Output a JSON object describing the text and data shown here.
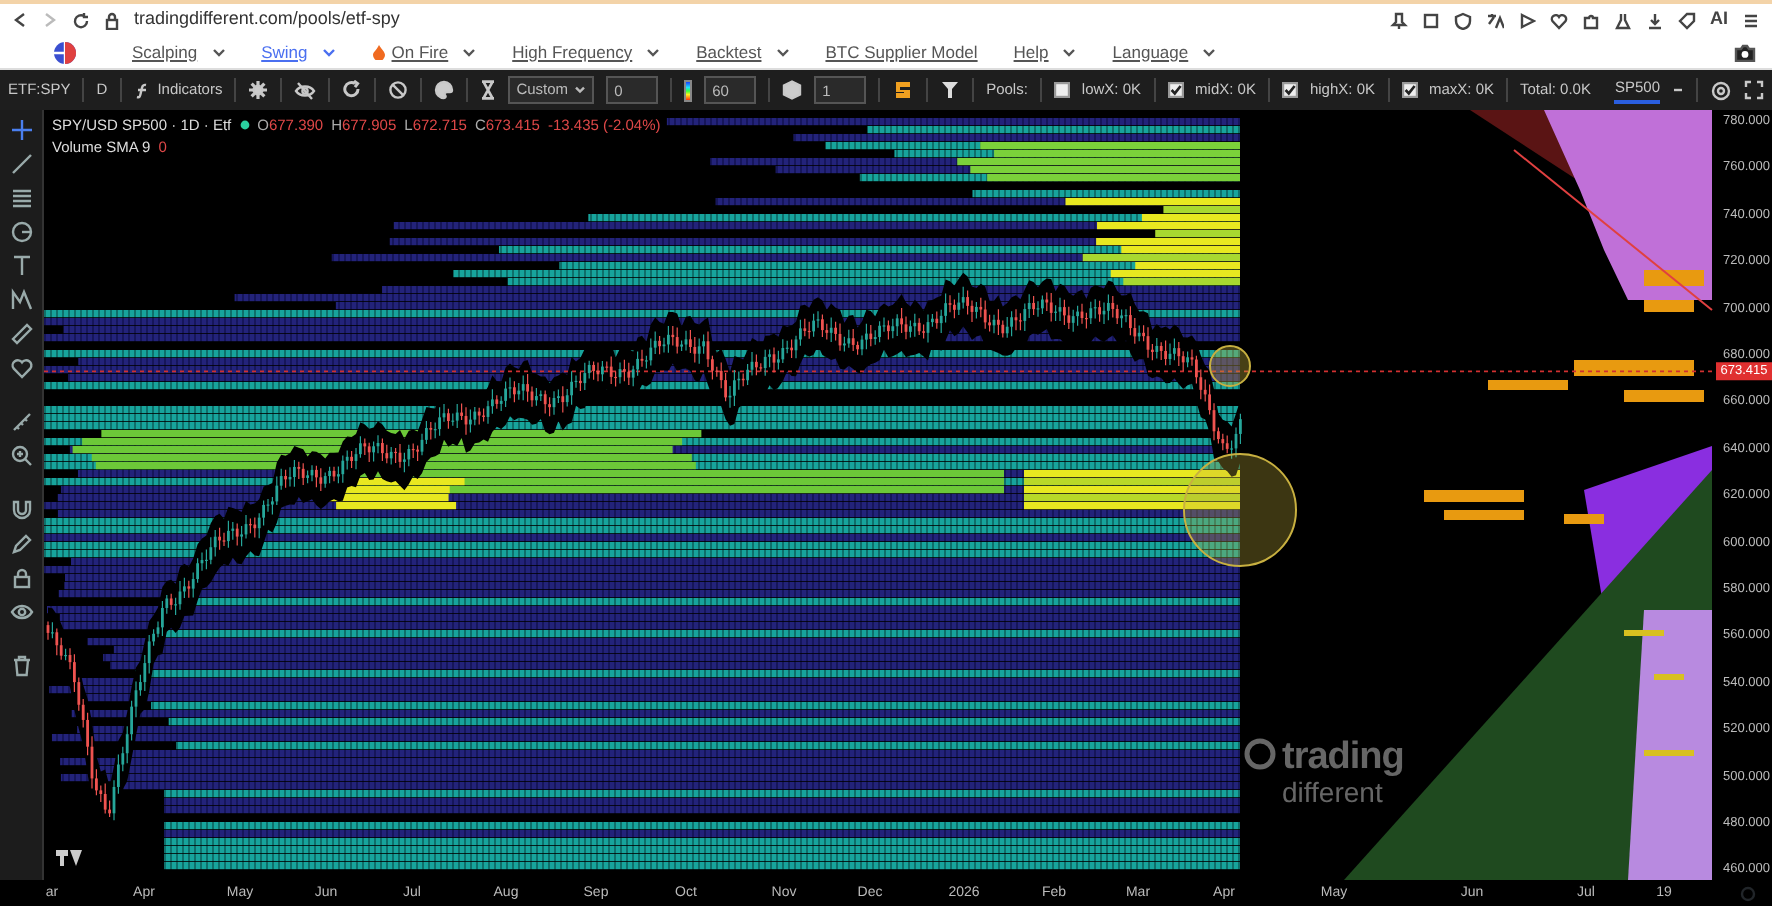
{
  "browser": {
    "url": "tradingdifferent.com/pools/etf-spy",
    "ai_label": "AI"
  },
  "nav": {
    "items": [
      {
        "label": "Scalping",
        "selected": false,
        "dropdown": true,
        "kind": "menu"
      },
      {
        "label": "Swing",
        "selected": true,
        "dropdown": true,
        "kind": "menu"
      },
      {
        "label": "On Fire",
        "selected": false,
        "dropdown": true,
        "kind": "hot"
      },
      {
        "label": "High Frequency",
        "selected": false,
        "dropdown": true,
        "kind": "menu"
      },
      {
        "label": "Backtest",
        "selected": false,
        "dropdown": true,
        "kind": "menu"
      },
      {
        "label": "BTC Supplier Model",
        "selected": false,
        "dropdown": false,
        "kind": "menu"
      },
      {
        "label": "Help",
        "selected": false,
        "dropdown": true,
        "kind": "menu"
      },
      {
        "label": "Language",
        "selected": false,
        "dropdown": true,
        "kind": "menu"
      }
    ]
  },
  "toolbar": {
    "symbol": "ETF:SPY",
    "interval": "D",
    "indicators": "Indicators",
    "range_select": "Custom",
    "range_value": "0",
    "gradient_value": "60",
    "step_value": "1",
    "pools_label": "Pools:",
    "pools": [
      {
        "label": "lowX: 0K",
        "checked": false
      },
      {
        "label": "midX: 0K",
        "checked": true
      },
      {
        "label": "highX: 0K",
        "checked": true
      },
      {
        "label": "maxX: 0K",
        "checked": true
      }
    ],
    "total": "Total: 0.0K",
    "preset": "SP500"
  },
  "legend": {
    "title": "SPY/USD SP500 · 1D · Etf",
    "ohlc": [
      {
        "label": "O",
        "value": "677.390"
      },
      {
        "label": "H",
        "value": "677.905"
      },
      {
        "label": "L",
        "value": "672.715"
      },
      {
        "label": "C",
        "value": "673.415"
      }
    ],
    "change": "-13.435 (-2.04%)",
    "indicator": "Volume SMA 9",
    "indicator_value": "0"
  },
  "watermark": {
    "line_1": "trading",
    "line_2": "different"
  },
  "price_axis": {
    "labels": [
      "780.000",
      "760.000",
      "740.000",
      "720.000",
      "700.000",
      "680.000",
      "660.000",
      "640.000",
      "620.000",
      "600.000",
      "580.000",
      "560.000",
      "540.000",
      "520.000",
      "500.000",
      "480.000",
      "460.000"
    ],
    "last_price": "673.415"
  },
  "time_axis": {
    "labels": [
      "ar",
      "Apr",
      "May",
      "Jun",
      "Jul",
      "Aug",
      "Sep",
      "Oct",
      "Nov",
      "Dec",
      "2026",
      "Feb",
      "Mar",
      "Apr",
      "May",
      "Jun",
      "Jul",
      "19"
    ]
  }
}
